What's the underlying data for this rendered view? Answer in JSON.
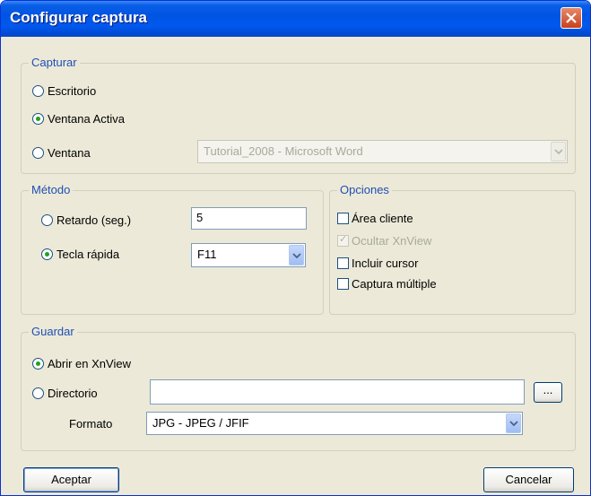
{
  "window": {
    "title": "Configurar captura"
  },
  "capturar": {
    "legend": "Capturar",
    "options": [
      {
        "label": "Escritorio",
        "selected": false
      },
      {
        "label": "Ventana Activa",
        "selected": true
      },
      {
        "label": "Ventana",
        "selected": false
      }
    ],
    "window_select": "Tutorial_2008 - Microsoft Word"
  },
  "metodo": {
    "legend": "Método",
    "retardo_label": "Retardo (seg.)",
    "retardo_value": "5",
    "tecla_label": "Tecla rápida",
    "tecla_value": "F11",
    "retardo_selected": false,
    "tecla_selected": true
  },
  "opciones": {
    "legend": "Opciones",
    "items": [
      {
        "label": "Área cliente",
        "checked": false,
        "disabled": false
      },
      {
        "label": "Ocultar XnView",
        "checked": true,
        "disabled": true
      },
      {
        "label": "Incluir cursor",
        "checked": false,
        "disabled": false
      },
      {
        "label": "Captura múltiple",
        "checked": false,
        "disabled": false
      }
    ]
  },
  "guardar": {
    "legend": "Guardar",
    "abrir_label": "Abrir en XnView",
    "directorio_label": "Directorio",
    "directorio_value": "",
    "browse_label": "...",
    "formato_label": "Formato",
    "formato_value": "JPG - JPEG / JFIF"
  },
  "buttons": {
    "ok": "Aceptar",
    "cancel": "Cancelar"
  },
  "colors": {
    "titlebar": "#0054e3",
    "legend": "#1f4fb5",
    "face": "#ece9d8",
    "radio_dot": "#21a121"
  }
}
